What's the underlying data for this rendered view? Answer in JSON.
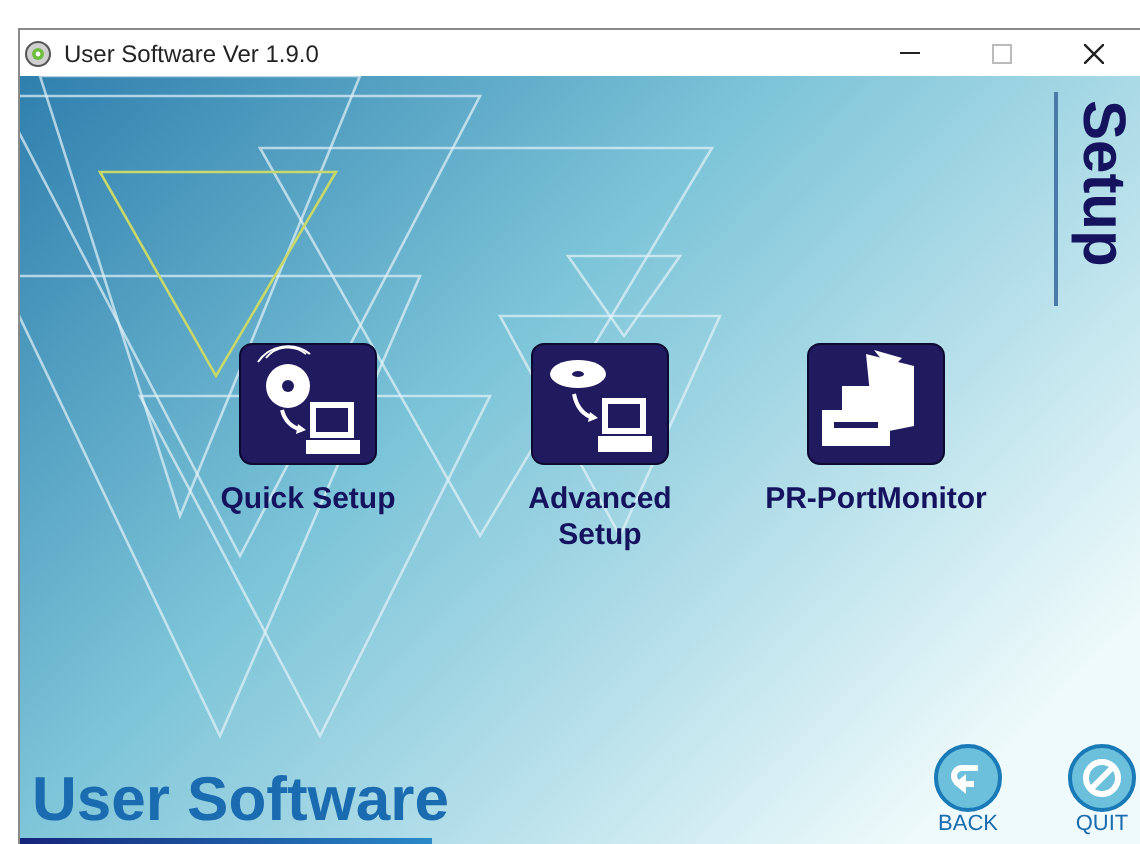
{
  "window": {
    "title": "User Software Ver 1.9.0"
  },
  "section_title": "Setup",
  "items": [
    {
      "kind": "quick",
      "label": "Quick Setup"
    },
    {
      "kind": "advanced",
      "label": "Advanced\nSetup"
    },
    {
      "kind": "monitor",
      "label": "PR-PortMonitor"
    }
  ],
  "brand": "User Software",
  "buttons": [
    {
      "kind": "back",
      "label": "BACK"
    },
    {
      "kind": "quit",
      "label": "QUIT"
    }
  ]
}
